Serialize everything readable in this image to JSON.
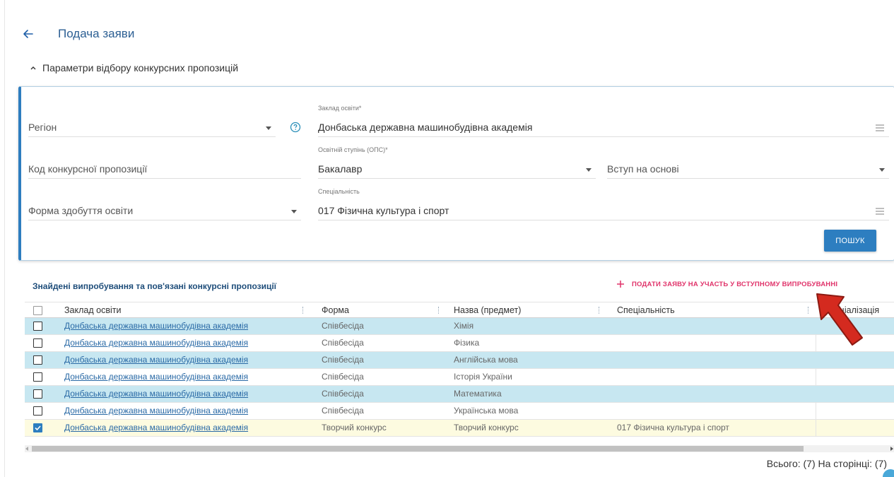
{
  "header": {
    "title": "Подача заяви"
  },
  "params_section": {
    "title": "Параметри відбору конкурсних пропозицій"
  },
  "filters": {
    "region": {
      "value": "Регіон"
    },
    "institution": {
      "label": "Заклад освіти*",
      "value": "Донбаська державна машинобудівна академія"
    },
    "offer_code": {
      "value": "Код конкурсної пропозиції"
    },
    "degree": {
      "label": "Освітній ступінь (ОПС)*",
      "value": "Бакалавр"
    },
    "admission_basis": {
      "value": "Вступ на основі"
    },
    "study_form": {
      "value": "Форма здобуття освіти"
    },
    "specialty": {
      "label": "Спеціальність",
      "value": "017 Фізична культура і спорт"
    },
    "search_button": "ПОШУК"
  },
  "results": {
    "title": "Знайдені випробування та пов'язані конкурсні пропозиції",
    "apply_action": "ПОДАТИ ЗАЯВУ НА УЧАСТЬ У ВСТУПНОМУ ВИПРОБУВАННІ",
    "columns": [
      "Заклад освіти",
      "Форма",
      "Назва (предмет)",
      "Спеціальність",
      "Спеціалізація"
    ],
    "rows": [
      {
        "institution": "Донбаська державна машинобудівна академія",
        "form": "Співбесіда",
        "subject": "Хімія",
        "specialty": "",
        "checked": false
      },
      {
        "institution": "Донбаська державна машинобудівна академія",
        "form": "Співбесіда",
        "subject": "Фізика",
        "specialty": "",
        "checked": false
      },
      {
        "institution": "Донбаська державна машинобудівна академія",
        "form": "Співбесіда",
        "subject": "Англійська мова",
        "specialty": "",
        "checked": false
      },
      {
        "institution": "Донбаська державна машинобудівна академія",
        "form": "Співбесіда",
        "subject": "Історія України",
        "specialty": "",
        "checked": false
      },
      {
        "institution": "Донбаська державна машинобудівна академія",
        "form": "Співбесіда",
        "subject": "Математика",
        "specialty": "",
        "checked": false
      },
      {
        "institution": "Донбаська державна машинобудівна академія",
        "form": "Співбесіда",
        "subject": "Українська мова",
        "specialty": "",
        "checked": false
      },
      {
        "institution": "Донбаська державна машинобудівна академія",
        "form": "Творчий конкурс",
        "subject": "Творчий конкурс",
        "specialty": "017 Фізична культура і спорт",
        "checked": true
      }
    ],
    "footer": "Всього: (7) На сторінці: (7)"
  },
  "colors": {
    "accent": "#2d7ec0",
    "row_alt": "#c7e7f1",
    "row_selected": "#fdfbe0",
    "action_pink": "#e0336a",
    "annotation_arrow": "#d42a1f"
  }
}
